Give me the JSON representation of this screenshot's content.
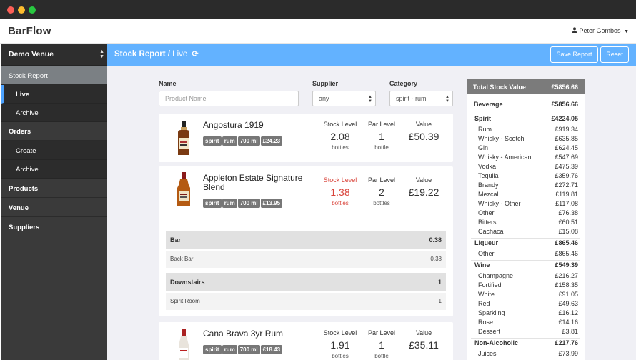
{
  "app": {
    "brand": "BarFlow",
    "user_name": "Peter Gombos"
  },
  "sidebar": {
    "venue": "Demo Venue",
    "items": [
      {
        "label": "Stock Report"
      },
      {
        "label": "Live"
      },
      {
        "label": "Archive"
      },
      {
        "label": "Orders"
      },
      {
        "label": "Create"
      },
      {
        "label": "Archive"
      },
      {
        "label": "Products"
      },
      {
        "label": "Venue"
      },
      {
        "label": "Suppliers"
      }
    ]
  },
  "header": {
    "title": "Stock Report /",
    "subtitle": "Live",
    "save_label": "Save Report",
    "reset_label": "Reset"
  },
  "filters": {
    "name_label": "Name",
    "name_placeholder": "Product Name",
    "supplier_label": "Supplier",
    "supplier_value": "any",
    "category_label": "Category",
    "category_value": "spirit - rum"
  },
  "metric_labels": {
    "stock": "Stock Level",
    "par": "Par Level",
    "value": "Value",
    "unit": "bottles",
    "par_unit": "bottle"
  },
  "products": [
    {
      "name": "Angostura 1919",
      "tags": [
        "spirit",
        "rum",
        "700 ml",
        "£24.23"
      ],
      "stock": "2.08",
      "stock_unit": "bottles",
      "par": "1",
      "par_unit": "bottle",
      "value": "£50.39"
    },
    {
      "name_line1": "Appleton Estate Signature",
      "name_line2": "Blend",
      "tags": [
        "spirit",
        "rum",
        "700 ml",
        "£13.95"
      ],
      "stock": "1.38",
      "stock_unit": "bottles",
      "par": "2",
      "par_unit": "bottles",
      "value": "£19.22",
      "locations": [
        {
          "name": "Bar",
          "value": "0.38",
          "sub": [
            {
              "name": "Back Bar",
              "value": "0.38"
            }
          ]
        },
        {
          "name": "Downstairs",
          "value": "1",
          "sub": [
            {
              "name": "Spirit Room",
              "value": "1"
            }
          ]
        }
      ]
    },
    {
      "name": "Cana Brava 3yr Rum",
      "tags": [
        "spirit",
        "rum",
        "700 ml",
        "£18.43"
      ],
      "stock": "1.91",
      "stock_unit": "bottles",
      "par": "1",
      "par_unit": "bottle",
      "value": "£35.11"
    }
  ],
  "summary": {
    "title": "Total Stock Value",
    "total": "£5856.66",
    "rows": [
      {
        "kind": "group",
        "name": "Beverage",
        "value": "£5856.66"
      },
      {
        "kind": "cat",
        "name": "Spirit",
        "value": "£4224.05"
      },
      {
        "kind": "item",
        "name": "Rum",
        "value": "£919.34"
      },
      {
        "kind": "item",
        "name": "Whisky - Scotch",
        "value": "£635.85"
      },
      {
        "kind": "item",
        "name": "Gin",
        "value": "£624.45"
      },
      {
        "kind": "item",
        "name": "Whisky - American",
        "value": "£547.69"
      },
      {
        "kind": "item",
        "name": "Vodka",
        "value": "£475.39"
      },
      {
        "kind": "item",
        "name": "Tequila",
        "value": "£359.76"
      },
      {
        "kind": "item",
        "name": "Brandy",
        "value": "£272.71"
      },
      {
        "kind": "item",
        "name": "Mezcal",
        "value": "£119.81"
      },
      {
        "kind": "item",
        "name": "Whisky - Other",
        "value": "£117.08"
      },
      {
        "kind": "item",
        "name": "Other",
        "value": "£76.38"
      },
      {
        "kind": "item",
        "name": "Bitters",
        "value": "£60.51"
      },
      {
        "kind": "item",
        "name": "Cachaca",
        "value": "£15.08"
      },
      {
        "kind": "cat",
        "name": "Liqueur",
        "value": "£865.46"
      },
      {
        "kind": "item",
        "name": "Other",
        "value": "£865.46"
      },
      {
        "kind": "cat",
        "name": "Wine",
        "value": "£549.39"
      },
      {
        "kind": "item",
        "name": "Champagne",
        "value": "£216.27"
      },
      {
        "kind": "item",
        "name": "Fortified",
        "value": "£158.35"
      },
      {
        "kind": "item",
        "name": "White",
        "value": "£91.05"
      },
      {
        "kind": "item",
        "name": "Red",
        "value": "£49.63"
      },
      {
        "kind": "item",
        "name": "Sparkling",
        "value": "£16.12"
      },
      {
        "kind": "item",
        "name": "Rose",
        "value": "£14.16"
      },
      {
        "kind": "item",
        "name": "Dessert",
        "value": "£3.81"
      },
      {
        "kind": "cat",
        "name": "Non-Alcoholic",
        "value": "£217.76"
      },
      {
        "kind": "item",
        "name": "Juices",
        "value": "£73.99"
      }
    ]
  },
  "icons": {
    "user": "user-icon",
    "refresh": "refresh-icon",
    "select": "select-arrows-icon",
    "bottle": "bottle-icon"
  },
  "colors": {
    "accent": "#63b2ff",
    "alert": "#d9443b",
    "sidebar": "#3a3a3a"
  }
}
